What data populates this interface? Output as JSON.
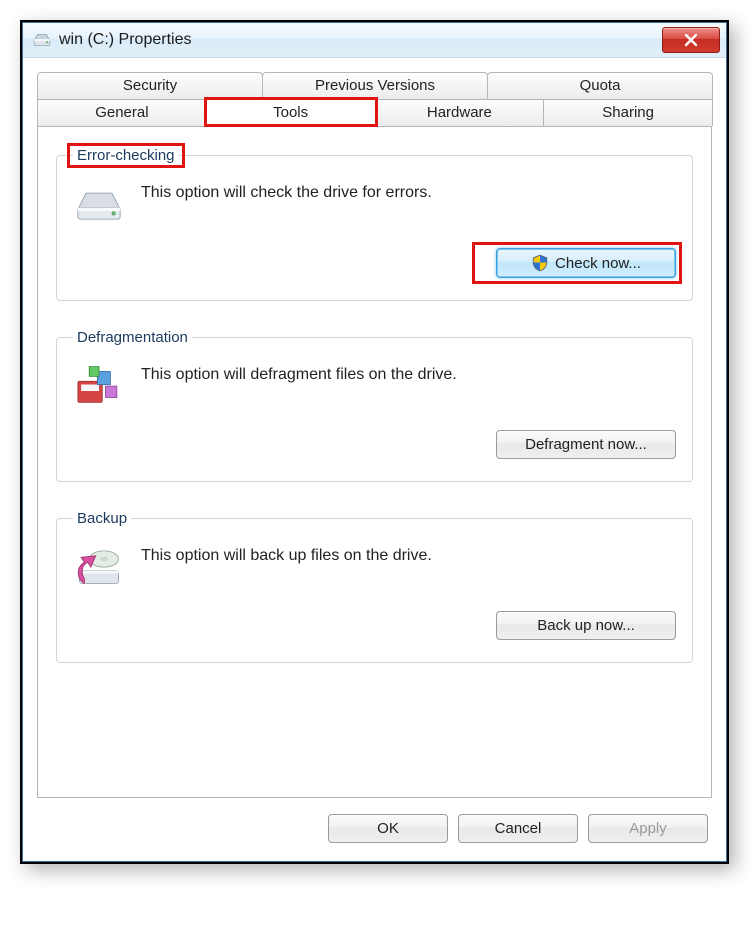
{
  "window": {
    "title": "win (C:) Properties"
  },
  "tabs": {
    "row_top": [
      "Security",
      "Previous Versions",
      "Quota"
    ],
    "row_bottom": [
      "General",
      "Tools",
      "Hardware",
      "Sharing"
    ],
    "active": "Tools"
  },
  "groups": {
    "error_checking": {
      "legend": "Error-checking",
      "description": "This option will check the drive for errors.",
      "button": "Check now..."
    },
    "defragmentation": {
      "legend": "Defragmentation",
      "description": "This option will defragment files on the drive.",
      "button": "Defragment now..."
    },
    "backup": {
      "legend": "Backup",
      "description": "This option will back up files on the drive.",
      "button": "Back up now..."
    }
  },
  "footer": {
    "ok": "OK",
    "cancel": "Cancel",
    "apply": "Apply"
  }
}
